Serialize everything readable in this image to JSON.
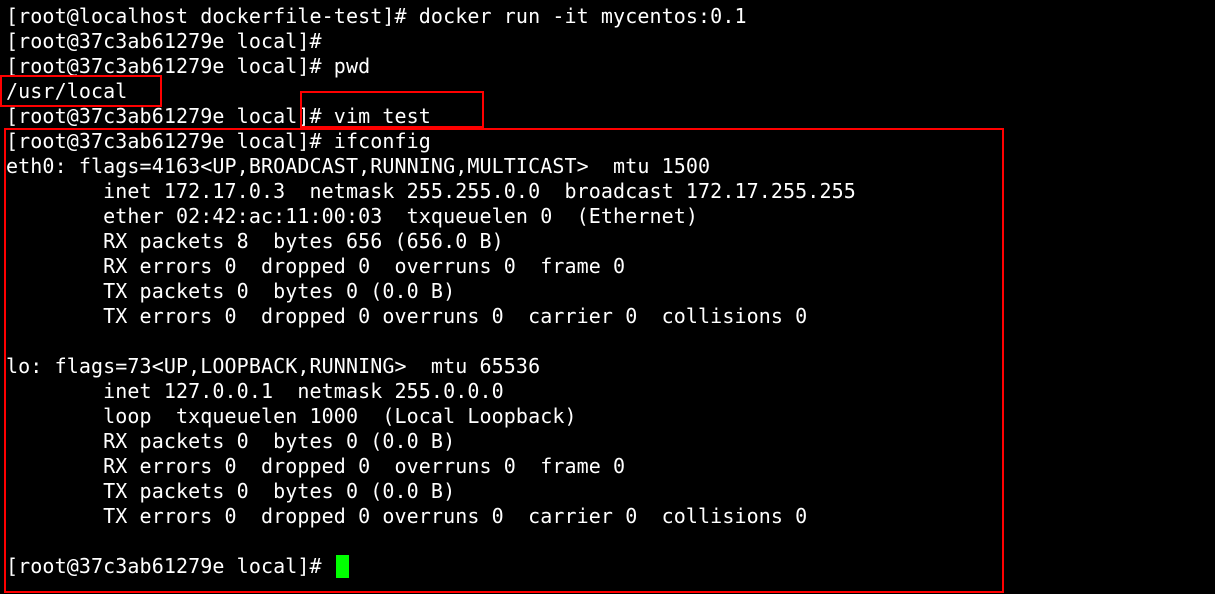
{
  "terminal": {
    "lines": [
      "[root@localhost dockerfile-test]# docker run -it mycentos:0.1",
      "[root@37c3ab61279e local]#",
      "[root@37c3ab61279e local]# pwd",
      "/usr/local",
      "[root@37c3ab61279e local]# vim test",
      "[root@37c3ab61279e local]# ifconfig",
      "eth0: flags=4163<UP,BROADCAST,RUNNING,MULTICAST>  mtu 1500",
      "        inet 172.17.0.3  netmask 255.255.0.0  broadcast 172.17.255.255",
      "        ether 02:42:ac:11:00:03  txqueuelen 0  (Ethernet)",
      "        RX packets 8  bytes 656 (656.0 B)",
      "        RX errors 0  dropped 0  overruns 0  frame 0",
      "        TX packets 0  bytes 0 (0.0 B)",
      "        TX errors 0  dropped 0 overruns 0  carrier 0  collisions 0",
      "",
      "lo: flags=73<UP,LOOPBACK,RUNNING>  mtu 65536",
      "        inet 127.0.0.1  netmask 255.0.0.0",
      "        loop  txqueuelen 1000  (Local Loopback)",
      "        RX packets 0  bytes 0 (0.0 B)",
      "        RX errors 0  dropped 0  overruns 0  frame 0",
      "        TX packets 0  bytes 0 (0.0 B)",
      "        TX errors 0  dropped 0 overruns 0  carrier 0  collisions 0",
      "",
      "[root@37c3ab61279e local]# "
    ]
  },
  "colors": {
    "background": "#000000",
    "text": "#ffffff",
    "cursor": "#00ff00",
    "highlight": "#ff0000"
  }
}
